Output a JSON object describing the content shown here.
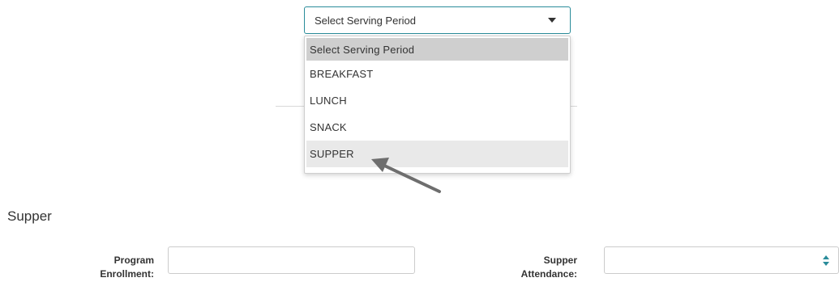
{
  "serving_period": {
    "selected_label": "Select Serving Period",
    "options": [
      {
        "label": "Select Serving Period"
      },
      {
        "label": "BREAKFAST"
      },
      {
        "label": "LUNCH"
      },
      {
        "label": "SNACK"
      },
      {
        "label": "SUPPER"
      }
    ],
    "accent_color": "#2a8c9a"
  },
  "section": {
    "title": "Supper"
  },
  "form": {
    "program_enrollment": {
      "label_line1": "Program",
      "label_line2": "Enrollment:",
      "value": "",
      "placeholder": ""
    },
    "supper_attendance": {
      "label_line1": "Supper",
      "label_line2": "Attendance:",
      "value": "",
      "placeholder": ""
    }
  },
  "icons": {
    "caret": "chevron-down-icon",
    "spinner": "spinner-arrows-icon",
    "annotation": "arrow-pointer-icon"
  }
}
